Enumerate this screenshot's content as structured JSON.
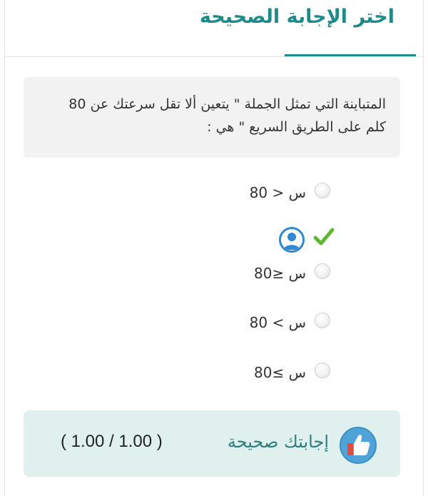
{
  "header": {
    "title": "اختر الإجابة الصحيحة"
  },
  "question": {
    "text": "المتباينة التي تمثل الجملة \" يتعين ألا تقل سرعتك عن 80 كلم على الطريق السريع \" هي :"
  },
  "options": [
    {
      "label": "س < 80",
      "selected": false
    },
    {
      "label": "س ≤80",
      "selected": false
    },
    {
      "label": "س > 80",
      "selected": false
    },
    {
      "label": "س ≥80",
      "selected": false
    }
  ],
  "answer_marker": {
    "user_icon": "user-avatar-icon",
    "check_icon": "checkmark-icon"
  },
  "feedback": {
    "message": "إجابتك صحيحة",
    "score": "( 1.00 / 1.00 )",
    "icon": "thumbs-up-icon"
  },
  "colors": {
    "accent": "#1f8a89",
    "feedback_bg": "#dff0ef",
    "question_bg": "#f2f2f2",
    "check": "#5cb82d",
    "avatar": "#2f8ad6",
    "thumb_circle": "#4fa3d8",
    "thumb_red": "#e04b3d"
  }
}
